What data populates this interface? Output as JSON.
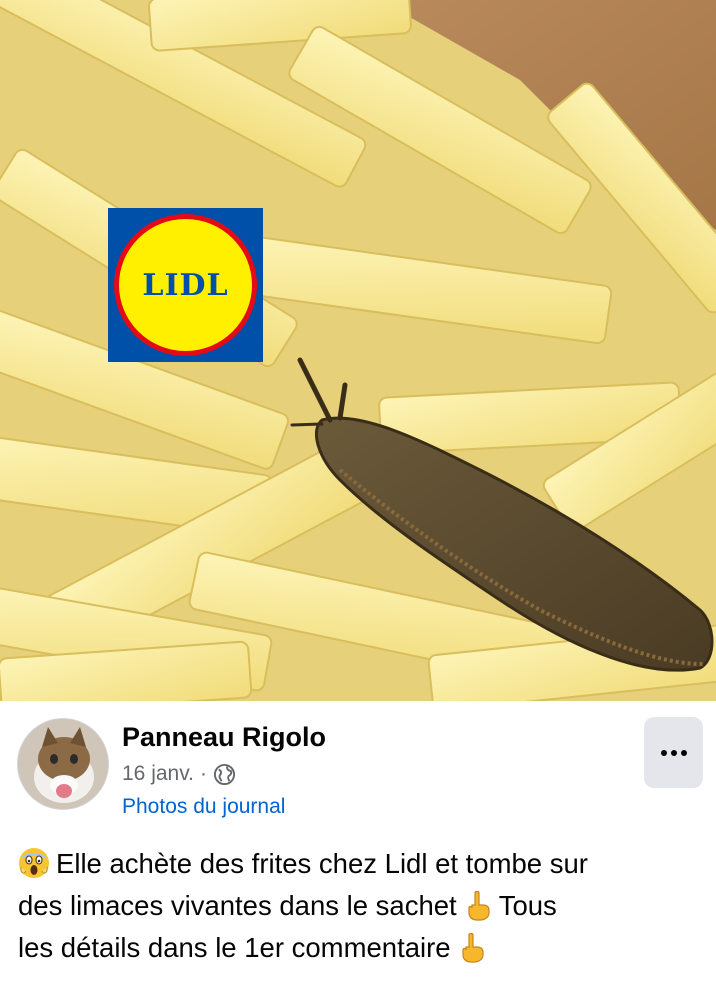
{
  "photo": {
    "logo_text": "LIDL",
    "logo_colors": {
      "blue": "#0050aa",
      "red": "#e60a14",
      "yellow": "#fff000"
    }
  },
  "post": {
    "author": "Panneau Rigolo",
    "date": "16 janv.",
    "separator": "·",
    "privacy_icon": "globe-icon",
    "album": "Photos du journal",
    "more_icon": "more-options-icon",
    "text_line1": "Elle achète des frites chez Lidl et tombe sur",
    "text_line2a": "des limaces vivantes dans le sachet",
    "text_line2b": "Tous",
    "text_line3": "les détails dans le 1er commentaire",
    "emoji_start": "screaming-face-emoji",
    "emoji_point": "pointing-down-emoji"
  },
  "colors": {
    "link": "#0064d1",
    "secondary_text": "#65676b",
    "button_bg": "#e4e6eb"
  }
}
